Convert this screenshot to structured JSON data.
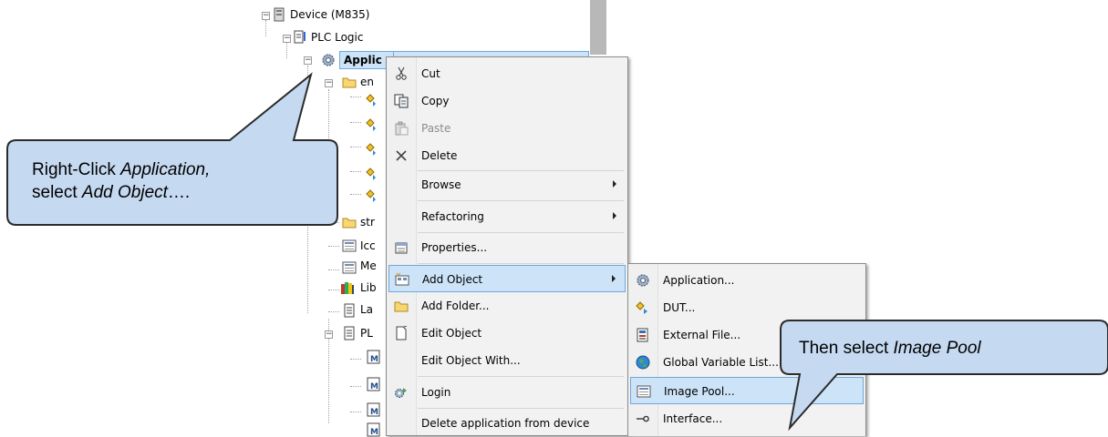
{
  "tree": {
    "items": [
      {
        "label": "Device (M835)",
        "icon": "device-icon"
      },
      {
        "label": "PLC Logic",
        "icon": "plc-logic-icon"
      },
      {
        "label": "Applic",
        "icon": "gear-icon"
      },
      {
        "label": "en",
        "icon": "folder-icon"
      },
      {
        "label": "str",
        "icon": "folder-icon"
      },
      {
        "label": "Icc",
        "icon": "image-pool-icon"
      },
      {
        "label": "Me",
        "icon": "image-pool-icon"
      },
      {
        "label": "Lib",
        "icon": "library-icon"
      },
      {
        "label": "La",
        "icon": "document-icon"
      },
      {
        "label": "PL",
        "icon": "document-icon"
      }
    ]
  },
  "context_menu": {
    "items": [
      {
        "label": "Cut",
        "icon": "scissors-icon"
      },
      {
        "label": "Copy",
        "icon": "copy-icon"
      },
      {
        "label": "Paste",
        "icon": "paste-icon",
        "disabled": true
      },
      {
        "label": "Delete",
        "icon": "delete-x-icon"
      },
      {
        "label": "Browse",
        "submenu": true
      },
      {
        "label": "Refactoring",
        "submenu": true
      },
      {
        "label": "Properties...",
        "icon": "properties-icon"
      },
      {
        "label": "Add Object",
        "icon": "add-object-icon",
        "submenu": true,
        "highlighted": true
      },
      {
        "label": "Add Folder...",
        "icon": "folder-icon"
      },
      {
        "label": "Edit Object",
        "icon": "edit-object-icon"
      },
      {
        "label": "Edit Object With..."
      },
      {
        "label": "Login",
        "icon": "login-icon"
      },
      {
        "label": "Delete application from device"
      }
    ]
  },
  "submenu": {
    "items": [
      {
        "label": "Application...",
        "icon": "gear-icon"
      },
      {
        "label": "DUT...",
        "icon": "dut-icon"
      },
      {
        "label": "External File...",
        "icon": "external-file-icon"
      },
      {
        "label": "Global Variable List...",
        "icon": "globe-icon"
      },
      {
        "label": "Image Pool...",
        "icon": "image-pool-icon",
        "highlighted": true
      },
      {
        "label": "Interface...",
        "icon": "interface-icon"
      }
    ]
  },
  "callouts": {
    "left": {
      "line1_prefix": "Right-Click ",
      "line1_italic": "Application,",
      "line2_prefix": "select ",
      "line2_italic": "Add Object",
      "line2_suffix": "…."
    },
    "right": {
      "prefix": "Then select ",
      "italic": "Image Pool"
    }
  },
  "colors": {
    "callout_fill": "#c5d9f1",
    "callout_stroke": "#2b2b2b",
    "highlight_fill": "#cde3f7",
    "highlight_border": "#6fa8dc"
  }
}
